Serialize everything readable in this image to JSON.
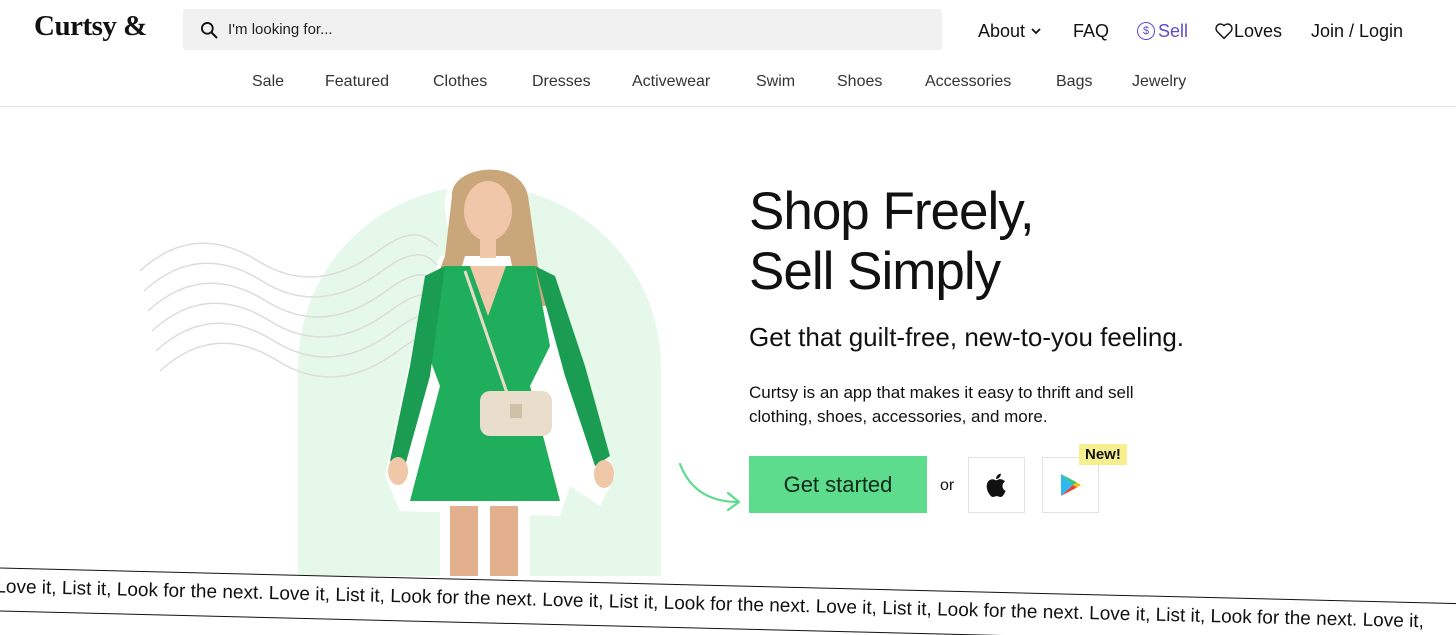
{
  "header": {
    "logo": "Curtsy &",
    "search": {
      "placeholder": "I'm looking for..."
    },
    "nav": {
      "about": "About",
      "faq": "FAQ",
      "sell": "Sell",
      "loves": "Loves",
      "join": "Join / Login"
    }
  },
  "categories": [
    "Sale",
    "Featured",
    "Clothes",
    "Dresses",
    "Activewear",
    "Swim",
    "Shoes",
    "Accessories",
    "Bags",
    "Jewelry"
  ],
  "hero": {
    "headline_line1": "Shop Freely,",
    "headline_line2": "Sell Simply",
    "subhead": "Get that guilt-free, new-to-you feeling.",
    "description": "Curtsy is an app that makes it easy to thrift and sell clothing, shoes, accessories, and more.",
    "cta": "Get started",
    "or": "or",
    "new_badge": "New!"
  },
  "ticker": "t. Love it, List it, Look for the next. Love it, List it, Look for the next. Love it, List it, Look for the next. Love it, List it, Look for the next. Love it, List it, Look for the next. Love it,",
  "colors": {
    "accent_green": "#5edc8d",
    "arch_green": "#e6f8ea",
    "sell_purple": "#5b4ccc",
    "badge_yellow": "#f6ef8d"
  },
  "icons": {
    "search": "search-icon",
    "chevron": "chevron-down-icon",
    "sell": "dollar-coin-icon",
    "loves": "heart-icon",
    "apple": "apple-icon",
    "play": "google-play-icon"
  }
}
